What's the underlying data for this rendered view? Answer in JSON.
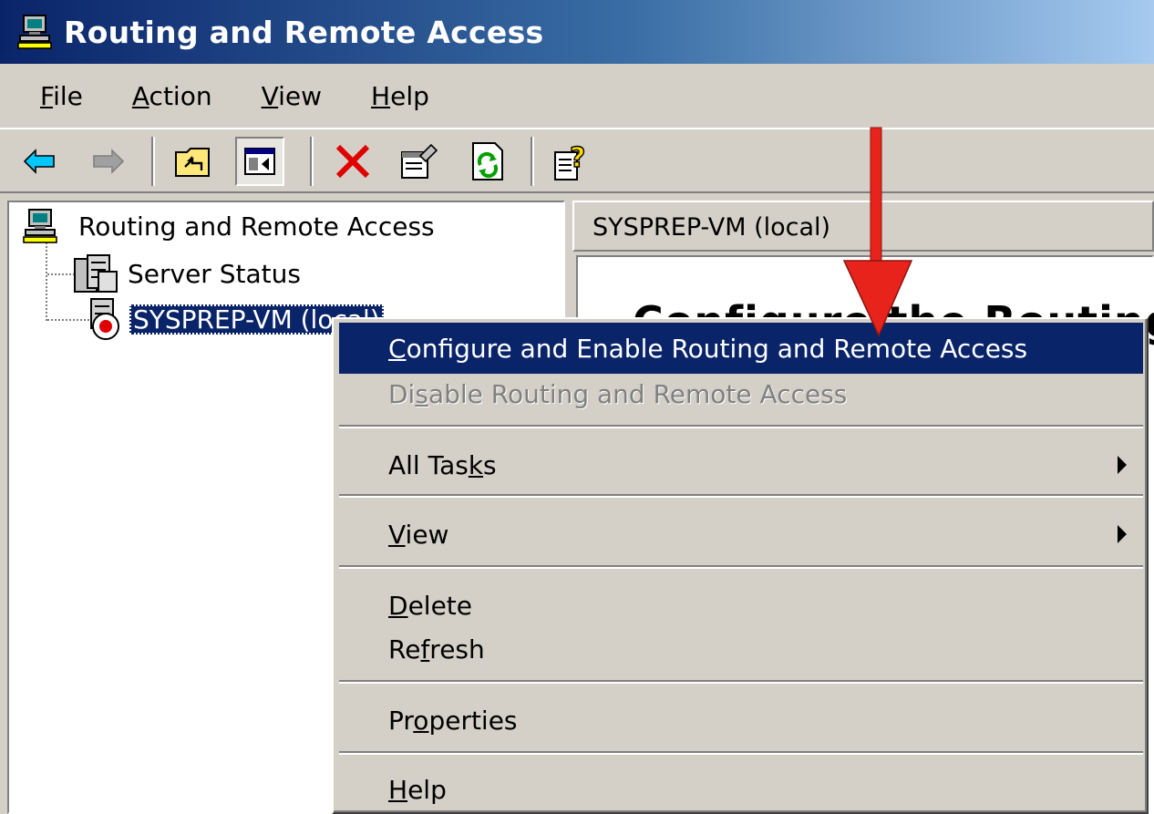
{
  "window": {
    "title": "Routing and Remote Access",
    "icon": "rras-computer-icon"
  },
  "menubar": {
    "items": [
      {
        "label_pre": "",
        "label_ul": "F",
        "label_post": "ile"
      },
      {
        "label_pre": "",
        "label_ul": "A",
        "label_post": "ction"
      },
      {
        "label_pre": "",
        "label_ul": "V",
        "label_post": "iew"
      },
      {
        "label_pre": "",
        "label_ul": "H",
        "label_post": "elp"
      }
    ]
  },
  "toolbar": {
    "buttons": [
      "back-icon",
      "forward-icon",
      "up-folder-icon",
      "show-hide-tree-icon",
      "delete-icon",
      "properties-icon",
      "refresh-icon",
      "help-icon"
    ]
  },
  "tree": {
    "root": "Routing and Remote Access",
    "server_status": "Server Status",
    "server": "SYSPREP-VM (local)"
  },
  "right_pane": {
    "header": "SYSPREP-VM (local)",
    "heading": "Configure the Routing"
  },
  "context_menu": {
    "configure": {
      "pre": "",
      "ul": "C",
      "post": "onfigure and Enable Routing and Remote Access"
    },
    "disable": {
      "pre": "Di",
      "ul": "s",
      "post": "able Routing and Remote Access"
    },
    "all_tasks": {
      "pre": "All Tas",
      "ul": "k",
      "post": "s"
    },
    "view": {
      "pre": "",
      "ul": "V",
      "post": "iew"
    },
    "delete": {
      "pre": "",
      "ul": "D",
      "post": "elete"
    },
    "refresh": {
      "pre": "Re",
      "ul": "f",
      "post": "resh"
    },
    "properties": {
      "pre": "Pr",
      "ul": "o",
      "post": "perties"
    },
    "help": {
      "pre": "",
      "ul": "H",
      "post": "elp"
    }
  },
  "colors": {
    "highlight": "#0a246a",
    "face": "#d4d0c8",
    "annotation_arrow": "#e8231b"
  }
}
